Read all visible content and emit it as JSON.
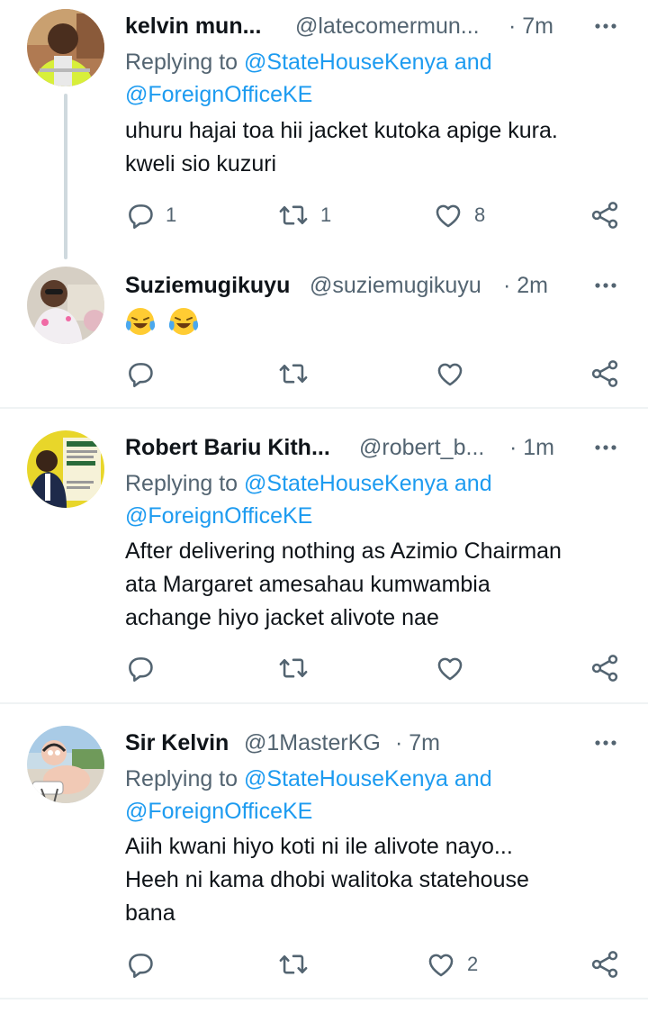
{
  "colors": {
    "link": "#1d9bf0",
    "secondary_text": "#536471",
    "primary_text": "#0f1419",
    "divider": "#eff3f4",
    "thread_line": "#cfd9de"
  },
  "tweets": [
    {
      "name": "kelvin mun...",
      "handle": "@latecomermun...",
      "time": "· 7m",
      "replying_prefix": "Replying to",
      "replying_to_1": "@StateHouseKenya",
      "replying_and": "and",
      "replying_to_2": "@ForeignOfficeKE",
      "text_lines": [
        "uhuru hajai toa hii jacket kutoka apige kura.",
        "kweli sio kuzuri"
      ],
      "reply_count": "1",
      "retweet_count": "1",
      "like_count": "8",
      "icons": [
        "reply-icon",
        "retweet-icon",
        "like-icon",
        "share-icon",
        "more-icon"
      ]
    },
    {
      "name": "Suziemugikuyu",
      "handle": "@suziemugikuyu",
      "time": "· 2m",
      "emojis": [
        "face-with-tears-of-joy",
        "face-with-tears-of-joy"
      ],
      "reply_count": "",
      "retweet_count": "",
      "like_count": ""
    },
    {
      "name": "Robert Bariu Kith...",
      "handle": "@robert_b...",
      "time": "· 1m",
      "replying_prefix": "Replying to",
      "replying_to_1": "@StateHouseKenya",
      "replying_and": "and",
      "replying_to_2": "@ForeignOfficeKE",
      "text_lines": [
        "After delivering nothing as Azimio Chairman",
        "ata Margaret amesahau kumwambia",
        "achange hiyo jacket alivote nae"
      ],
      "reply_count": "",
      "retweet_count": "",
      "like_count": ""
    },
    {
      "name": "Sir Kelvin",
      "handle": "@1MasterKG",
      "time": "· 7m",
      "replying_prefix": "Replying to",
      "replying_to_1": "@StateHouseKenya",
      "replying_and": "and",
      "replying_to_2": "@ForeignOfficeKE",
      "text_lines": [
        "Aiih kwani hiyo koti ni ile alivote nayo...",
        "Heeh ni kama dhobi walitoka statehouse",
        "bana"
      ],
      "reply_count": "",
      "retweet_count": "",
      "like_count": "2"
    }
  ]
}
